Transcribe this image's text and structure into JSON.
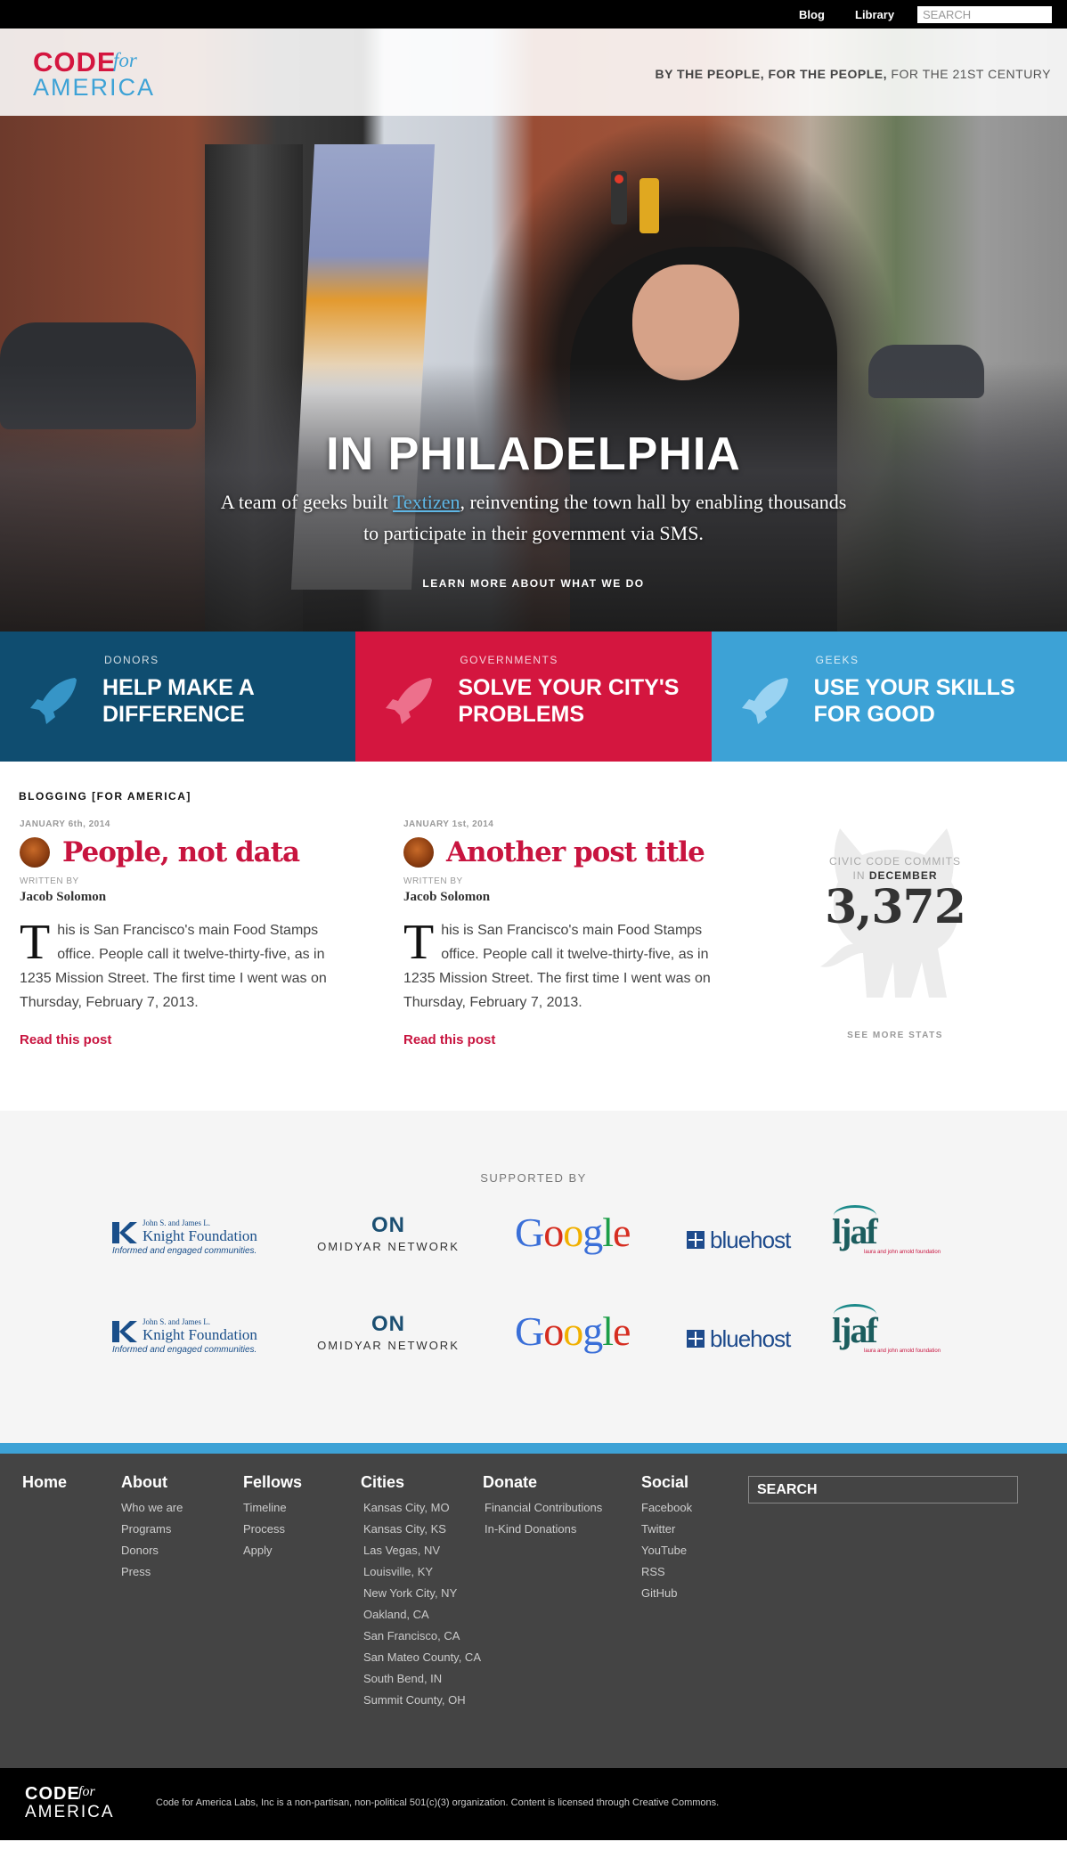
{
  "topbar": {
    "blog": "Blog",
    "library": "Library",
    "search_placeholder": "SEARCH"
  },
  "header": {
    "logo_code": "CODE",
    "logo_for": "for",
    "logo_america": "AMERICA",
    "tagline_strong": "BY THE PEOPLE, FOR THE PEOPLE,",
    "tagline_rest": " FOR THE 21ST CENTURY"
  },
  "hero": {
    "title": "IN PHILADELPHIA",
    "desc_before": "A team of geeks built ",
    "desc_link": "Textizen",
    "desc_after": ", reinventing the town hall by enabling thousands to participate in their government via SMS.",
    "cta": "LEARN MORE ABOUT WHAT WE DO"
  },
  "tiles": [
    {
      "kicker": "DONORS",
      "heading": "HELP MAKE A DIFFERENCE",
      "color": "#0f4d70",
      "icon": "rocket-icon"
    },
    {
      "kicker": "GOVERNMENTS",
      "heading": "SOLVE YOUR CITY'S PROBLEMS",
      "color": "#d4163f",
      "icon": "rocket-icon"
    },
    {
      "kicker": "GEEKS",
      "heading": "USE YOUR SKILLS FOR GOOD",
      "color": "#3da2d6",
      "icon": "rocket-icon"
    }
  ],
  "blog": {
    "label": "BLOGGING [FOR AMERICA]",
    "posts": [
      {
        "date": "JANUARY 6th, 2014",
        "title": "People, not data",
        "written_by": "WRITTEN BY",
        "author": "Jacob Solomon",
        "dropcap": "T",
        "body": "his is San Francisco's main Food Stamps office. People call it twelve-thirty-five, as in 1235 Mission Street. The first time I went was on Thursday, February 7, 2013.",
        "read": "Read this post"
      },
      {
        "date": "JANUARY 1st, 2014",
        "title": "Another post title",
        "written_by": "WRITTEN BY",
        "author": "Jacob Solomon",
        "dropcap": "T",
        "body": "his is San Francisco's main Food Stamps office. People call it twelve-thirty-five, as in 1235 Mission Street. The first time I went was on Thursday, February 7, 2013.",
        "read": "Read this post"
      }
    ],
    "stats": {
      "label1": "CIVIC CODE COMMITS",
      "label2_pre": "IN ",
      "label2_month": "DECEMBER",
      "number": "3,372",
      "more": "SEE MORE STATS"
    }
  },
  "supported": {
    "label": "SUPPORTED BY",
    "knight": {
      "t1": "John S. and James L.",
      "t2": "Knight Foundation",
      "t3": "Informed and engaged communities."
    },
    "omidyar": {
      "on": "ON",
      "name": "OMIDYAR NETWORK"
    },
    "google": [
      "G",
      "o",
      "o",
      "g",
      "l",
      "e"
    ],
    "bluehost": "bluehost",
    "ljaf": {
      "name": "ljaf",
      "sub": "laura and john arnold foundation"
    }
  },
  "footer": {
    "home": "Home",
    "about": {
      "title": "About",
      "items": [
        "Who we are",
        "Programs",
        "Donors",
        "Press"
      ]
    },
    "fellows": {
      "title": "Fellows",
      "items": [
        "Timeline",
        "Process",
        "Apply"
      ]
    },
    "cities": {
      "title": "Cities",
      "items": [
        "Kansas City, MO",
        "Kansas City, KS",
        "Las Vegas, NV",
        "Louisville, KY",
        "New York City, NY",
        "Oakland, CA",
        "San Francisco, CA",
        "San Mateo County, CA",
        "South Bend, IN",
        "Summit County, OH"
      ]
    },
    "donate": {
      "title": "Donate",
      "items": [
        "Financial Contributions",
        "In-Kind Donations"
      ]
    },
    "social": {
      "title": "Social",
      "items": [
        "Facebook",
        "Twitter",
        "YouTube",
        "RSS",
        "GitHub"
      ]
    },
    "search_placeholder": "SEARCH"
  },
  "bottom": {
    "logo_code": "CODE",
    "logo_for": "for",
    "logo_america": "AMERICA",
    "legal": "Code for America Labs, Inc is a non-partisan, non-political 501(c)(3) organization. Content is licensed through Creative Commons."
  }
}
